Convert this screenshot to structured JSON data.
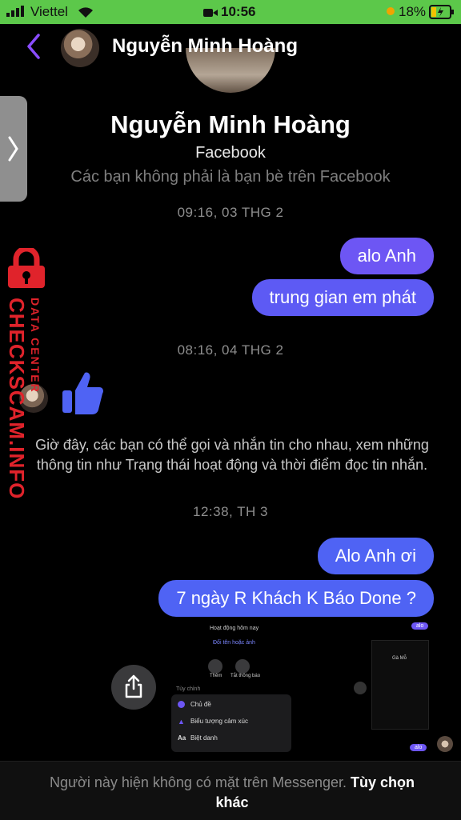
{
  "status_bar": {
    "carrier": "Viettel",
    "time": "10:56",
    "battery": "18%"
  },
  "header": {
    "contact_name": "Nguyễn Minh Hoàng"
  },
  "profile": {
    "name": "Nguyễn Minh Hoàng",
    "platform": "Facebook",
    "relation_note": "Các bạn không phải là bạn bè trên Facebook"
  },
  "messages": {
    "ts1": "09:16, 03 THG 2",
    "m1": "alo Anh",
    "m2": "trung gian em phát",
    "ts2": "08:16, 04 THG 2",
    "info": "Giờ đây, các bạn có thể gọi và nhắn tin cho nhau, xem những thông tin như Trạng thái hoạt động và thời điểm đọc tin nhắn.",
    "ts3": "12:38, TH 3",
    "m3": "Alo Anh ơi",
    "m4": "7 ngày R Khách K Báo Done ?"
  },
  "watermark": {
    "main": "CHECKSCAM.INFO",
    "sub": "DATA CENTER"
  },
  "embedded_screenshot": {
    "top_text": "Hoạt động hôm nay",
    "link": "Đổi tên hoặc ảnh",
    "action1": "Thêm",
    "action2": "Tắt thông báo",
    "section": "Tùy chỉnh",
    "menu1": "Chủ đề",
    "menu2": "Biểu tượng cảm xúc",
    "menu3": "Biệt danh",
    "mini_name": "Gà Mỗ",
    "bubble_alo": "alo"
  },
  "footer": {
    "text": "Người này hiện không có mặt trên Messenger.",
    "link": "Tùy chọn khác"
  },
  "colors": {
    "status_green": "#5cc84a",
    "bubble_purple": "#6d56f4",
    "bubble_blue": "#4f63f4",
    "accent": "#7b4dff"
  }
}
